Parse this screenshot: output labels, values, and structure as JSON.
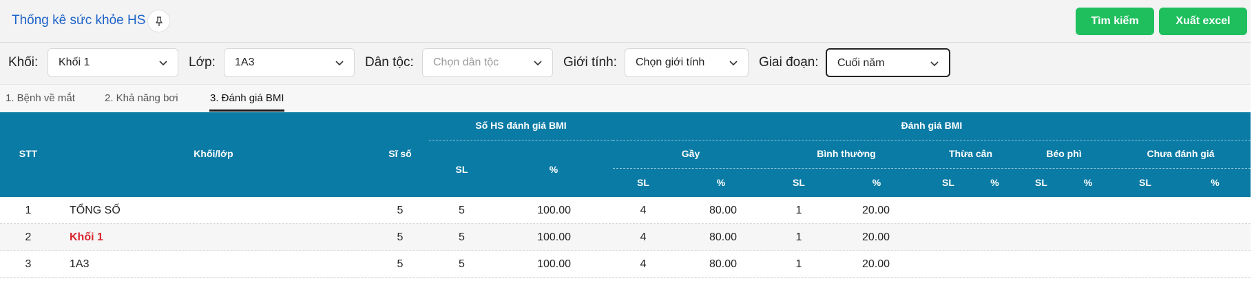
{
  "header": {
    "title": "Thống kê sức khỏe HS",
    "search_label": "Tìm kiếm",
    "export_label": "Xuất excel"
  },
  "filters": {
    "khoi": {
      "label": "Khối:",
      "value": "Khối 1"
    },
    "lop": {
      "label": "Lớp:",
      "value": "1A3"
    },
    "dantoc": {
      "label": "Dân tộc:",
      "placeholder": "Chọn dân tộc"
    },
    "gioitinh": {
      "label": "Giới tính:",
      "value": "Chọn giới tính"
    },
    "giaidoan": {
      "label": "Giai đoạn:",
      "value": "Cuối năm"
    }
  },
  "tabs": [
    {
      "label": "1. Bệnh về mắt"
    },
    {
      "label": "2. Khả năng bơi"
    },
    {
      "label": "3. Đánh giá BMI"
    }
  ],
  "table": {
    "headers": {
      "stt": "STT",
      "khoilop": "Khối/lớp",
      "siso": "Sĩ số",
      "so_hs": "Số HS đánh giá BMI",
      "danh_gia": "Đánh giá BMI",
      "gay": "Gầy",
      "binh_thuong": "Bình thường",
      "thua_can": "Thừa cân",
      "beo_phi": "Béo phì",
      "chua_danh_gia": "Chưa đánh giá",
      "sl": "SL",
      "pct": "%"
    },
    "rows": [
      {
        "stt": "1",
        "name": "TỔNG SỐ",
        "siso": "5",
        "sl": "5",
        "pct": "100.00",
        "gay_sl": "4",
        "gay_pct": "80.00",
        "bt_sl": "1",
        "bt_pct": "20.00"
      },
      {
        "stt": "2",
        "name": "Khối 1",
        "siso": "5",
        "sl": "5",
        "pct": "100.00",
        "gay_sl": "4",
        "gay_pct": "80.00",
        "bt_sl": "1",
        "bt_pct": "20.00"
      },
      {
        "stt": "3",
        "name": "1A3",
        "siso": "5",
        "sl": "5",
        "pct": "100.00",
        "gay_sl": "4",
        "gay_pct": "80.00",
        "bt_sl": "1",
        "bt_pct": "20.00"
      }
    ]
  },
  "colors": {
    "accent_green": "#1fbf5e",
    "title_blue": "#1e63c8",
    "table_header": "#0a7ba5",
    "highlight_red": "#d9262c"
  }
}
